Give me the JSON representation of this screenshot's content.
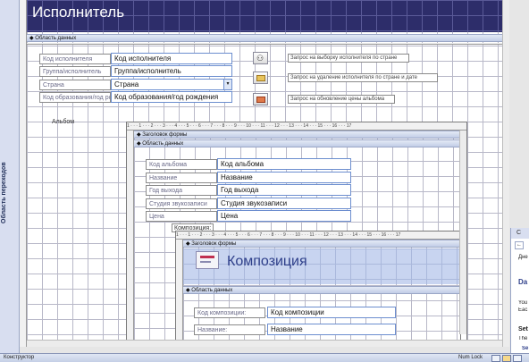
{
  "form": {
    "title": "Исполнитель",
    "section_data": "Область данных",
    "side_label": "Область переходов",
    "fields": [
      {
        "label": "Код исполнителя",
        "value": "Код исполнителя"
      },
      {
        "label": "Группа/исполнитель",
        "value": "Группа/исполнитель"
      },
      {
        "label": "Страна",
        "value": "Страна"
      },
      {
        "label": "Код образования/год ро",
        "value": "Код образования/год рождения"
      }
    ],
    "buttons": [
      {
        "label": "Запрос на выборку исполнителя по стране",
        "icon": "binoculars-icon"
      },
      {
        "label": "Запрос на удаление исполнителя по стране и дате",
        "icon": "delete-query-icon"
      },
      {
        "label": "Запрос на обновление цены альбома",
        "icon": "update-query-icon"
      }
    ],
    "album_label": "Альбом"
  },
  "album_sub": {
    "header_section": "Заголовок формы",
    "data_section": "Область данных",
    "fields": [
      {
        "label": "Код альбома",
        "value": "Код альбома"
      },
      {
        "label": "Название",
        "value": "Название"
      },
      {
        "label": "Год выхода",
        "value": "Год выхода"
      },
      {
        "label": "Студия звукозаписи",
        "value": "Студия звукозаписи"
      },
      {
        "label": "Цена",
        "value": "Цена"
      }
    ],
    "composition_label": "Композиция:"
  },
  "composition_sub": {
    "header_section": "Заголовок формы",
    "title": "Композиция",
    "data_section": "Область данных",
    "fields": [
      {
        "label": "Код композиции:",
        "value": "Код композиции"
      },
      {
        "label": "Название:",
        "value": "Название"
      }
    ]
  },
  "right_panel": {
    "title": "С",
    "lines": [
      "Дне",
      "Da",
      "You",
      "Eac",
      "Set",
      "The",
      "Se"
    ]
  },
  "status": {
    "left": "Конструктор",
    "right": "Num Lock"
  },
  "ruler_text": "1 · · · 1 · · · 2 · · · 3 · · · 4 · · · 5 · · · 6 · · · 7 · · · 8 · · · 9 · · · 10 · · · 11 · · · 12 · · · 13 · · · 14 · · · 15 · · · 16 · · · 17"
}
